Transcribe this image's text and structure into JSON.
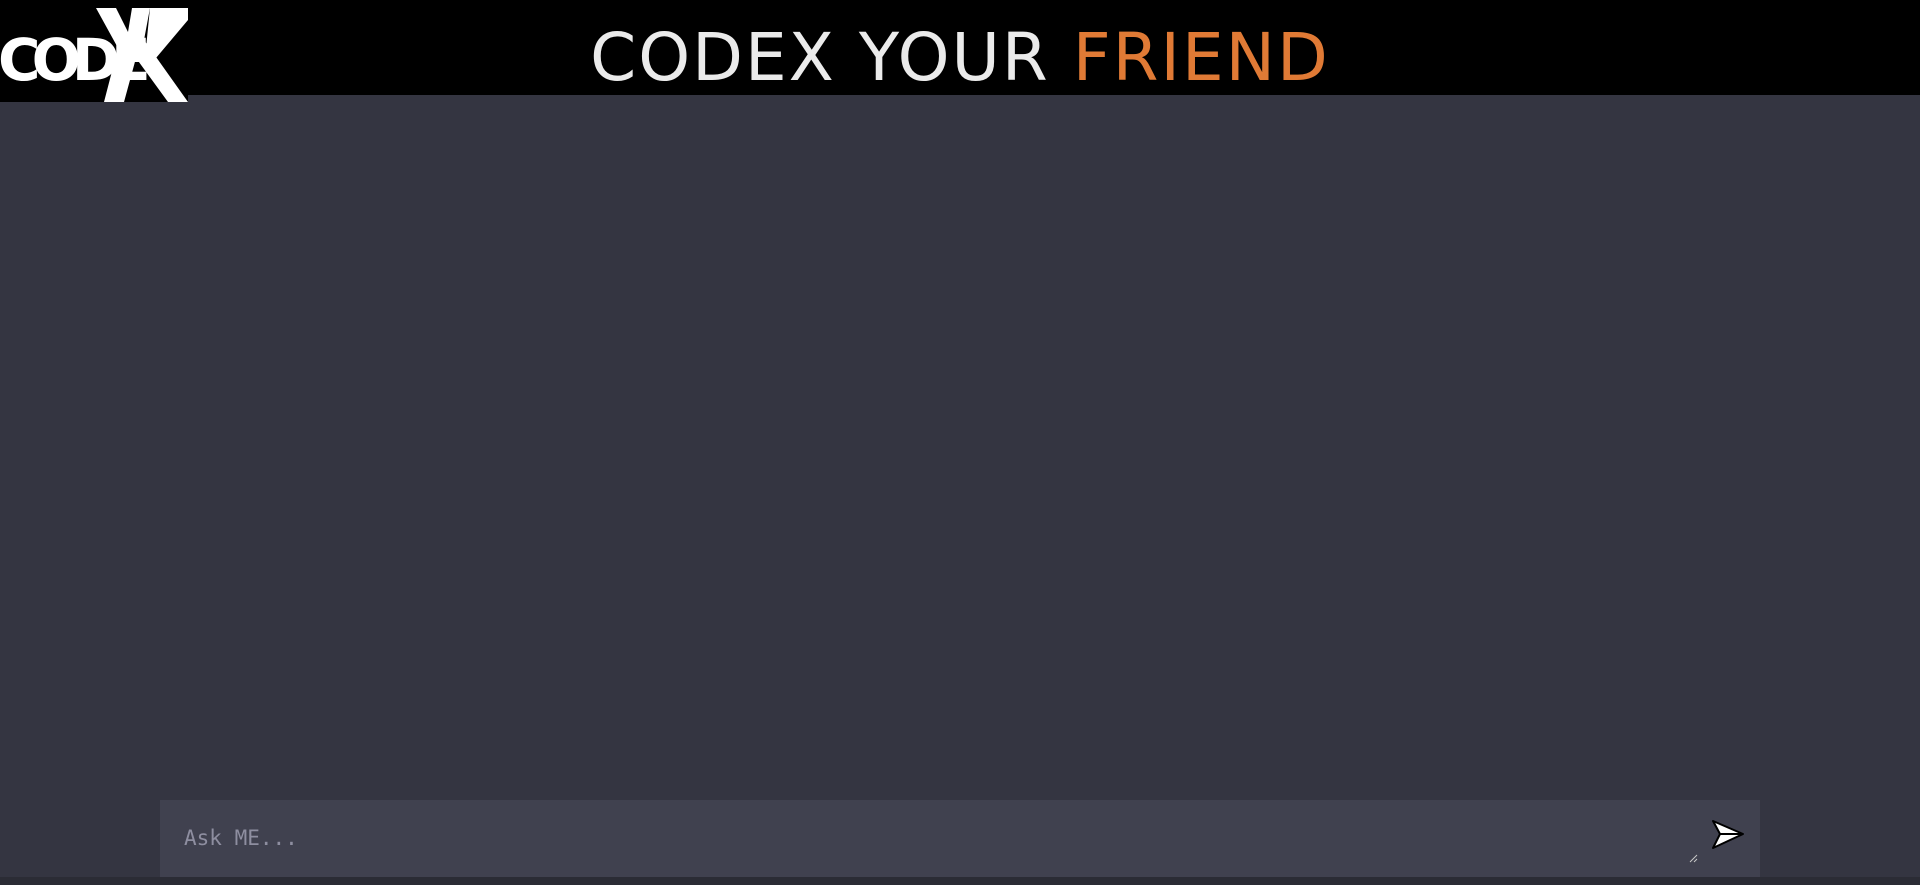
{
  "header": {
    "logo_text": "CODEX",
    "title_main": "CODEX YOUR ",
    "title_accent": "FRIEND"
  },
  "composer": {
    "placeholder": "Ask ME...",
    "value": "",
    "send_icon": "send-icon"
  },
  "colors": {
    "header_bg": "#000000",
    "page_bg": "#343541",
    "composer_bg": "#40414f",
    "accent": "#e07a35",
    "title_text": "#ebebeb"
  }
}
